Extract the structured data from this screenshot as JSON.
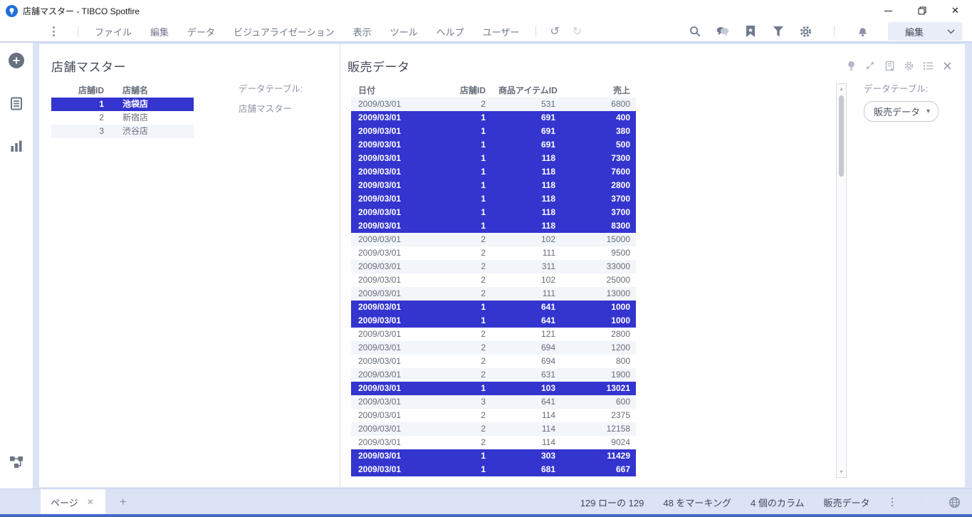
{
  "window": {
    "title": "店舗マスター - TIBCO Spotfire"
  },
  "menubar": {
    "menus": [
      "ファイル",
      "編集",
      "データ",
      "ビジュアライゼーション",
      "表示",
      "ツール",
      "ヘルプ",
      "ユーザー"
    ],
    "undo_glyph": "↺",
    "redo_glyph": "↻",
    "mode_dropdown": "編集"
  },
  "panels": {
    "left": {
      "title": "店舗マスター",
      "columns": [
        "店舗ID",
        "店舗名"
      ],
      "rows": [
        {
          "cells": [
            "1",
            "池袋店"
          ],
          "marked": true
        },
        {
          "cells": [
            "2",
            "新宿店"
          ],
          "marked": false
        },
        {
          "cells": [
            "3",
            "渋谷店"
          ],
          "marked": false
        }
      ],
      "legend_label": "データテーブル:",
      "legend_value": "店舗マスター"
    },
    "right": {
      "title": "販売データ",
      "columns": [
        "日付",
        "店舗ID",
        "商品アイテムID",
        "売上"
      ],
      "rows": [
        {
          "cells": [
            "2009/03/01",
            "2",
            "531",
            "6800"
          ],
          "marked": false
        },
        {
          "cells": [
            "2009/03/01",
            "1",
            "691",
            "400"
          ],
          "marked": true
        },
        {
          "cells": [
            "2009/03/01",
            "1",
            "691",
            "380"
          ],
          "marked": true
        },
        {
          "cells": [
            "2009/03/01",
            "1",
            "691",
            "500"
          ],
          "marked": true
        },
        {
          "cells": [
            "2009/03/01",
            "1",
            "118",
            "7300"
          ],
          "marked": true
        },
        {
          "cells": [
            "2009/03/01",
            "1",
            "118",
            "7600"
          ],
          "marked": true
        },
        {
          "cells": [
            "2009/03/01",
            "1",
            "118",
            "2800"
          ],
          "marked": true
        },
        {
          "cells": [
            "2009/03/01",
            "1",
            "118",
            "3700"
          ],
          "marked": true
        },
        {
          "cells": [
            "2009/03/01",
            "1",
            "118",
            "3700"
          ],
          "marked": true
        },
        {
          "cells": [
            "2009/03/01",
            "1",
            "118",
            "8300"
          ],
          "marked": true
        },
        {
          "cells": [
            "2009/03/01",
            "2",
            "102",
            "15000"
          ],
          "marked": false
        },
        {
          "cells": [
            "2009/03/01",
            "2",
            "111",
            "9500"
          ],
          "marked": false
        },
        {
          "cells": [
            "2009/03/01",
            "2",
            "311",
            "33000"
          ],
          "marked": false
        },
        {
          "cells": [
            "2009/03/01",
            "2",
            "102",
            "25000"
          ],
          "marked": false
        },
        {
          "cells": [
            "2009/03/01",
            "2",
            "111",
            "13000"
          ],
          "marked": false
        },
        {
          "cells": [
            "2009/03/01",
            "1",
            "641",
            "1000"
          ],
          "marked": true
        },
        {
          "cells": [
            "2009/03/01",
            "1",
            "641",
            "1000"
          ],
          "marked": true
        },
        {
          "cells": [
            "2009/03/01",
            "2",
            "121",
            "2800"
          ],
          "marked": false
        },
        {
          "cells": [
            "2009/03/01",
            "2",
            "694",
            "1200"
          ],
          "marked": false
        },
        {
          "cells": [
            "2009/03/01",
            "2",
            "694",
            "800"
          ],
          "marked": false
        },
        {
          "cells": [
            "2009/03/01",
            "2",
            "631",
            "1900"
          ],
          "marked": false
        },
        {
          "cells": [
            "2009/03/01",
            "1",
            "103",
            "13021"
          ],
          "marked": true
        },
        {
          "cells": [
            "2009/03/01",
            "3",
            "641",
            "600"
          ],
          "marked": false
        },
        {
          "cells": [
            "2009/03/01",
            "2",
            "114",
            "2375"
          ],
          "marked": false
        },
        {
          "cells": [
            "2009/03/01",
            "2",
            "114",
            "12158"
          ],
          "marked": false
        },
        {
          "cells": [
            "2009/03/01",
            "2",
            "114",
            "9024"
          ],
          "marked": false
        },
        {
          "cells": [
            "2009/03/01",
            "1",
            "303",
            "11429"
          ],
          "marked": true
        },
        {
          "cells": [
            "2009/03/01",
            "1",
            "681",
            "667"
          ],
          "marked": true
        }
      ],
      "legend_label": "データテーブル:",
      "legend_value": "販売データ",
      "legend_caret": "▾"
    }
  },
  "statusbar": {
    "tab_label": "ページ",
    "tab_close": "✕",
    "add_tab": "+",
    "items": [
      "129 ローの 129",
      "48 をマーキング",
      "4 個のカラム",
      "販売データ"
    ]
  },
  "colors": {
    "marking_blue": "#3434cf",
    "page_bg": "#dce3f5",
    "stripe": "#f2f5fa"
  }
}
